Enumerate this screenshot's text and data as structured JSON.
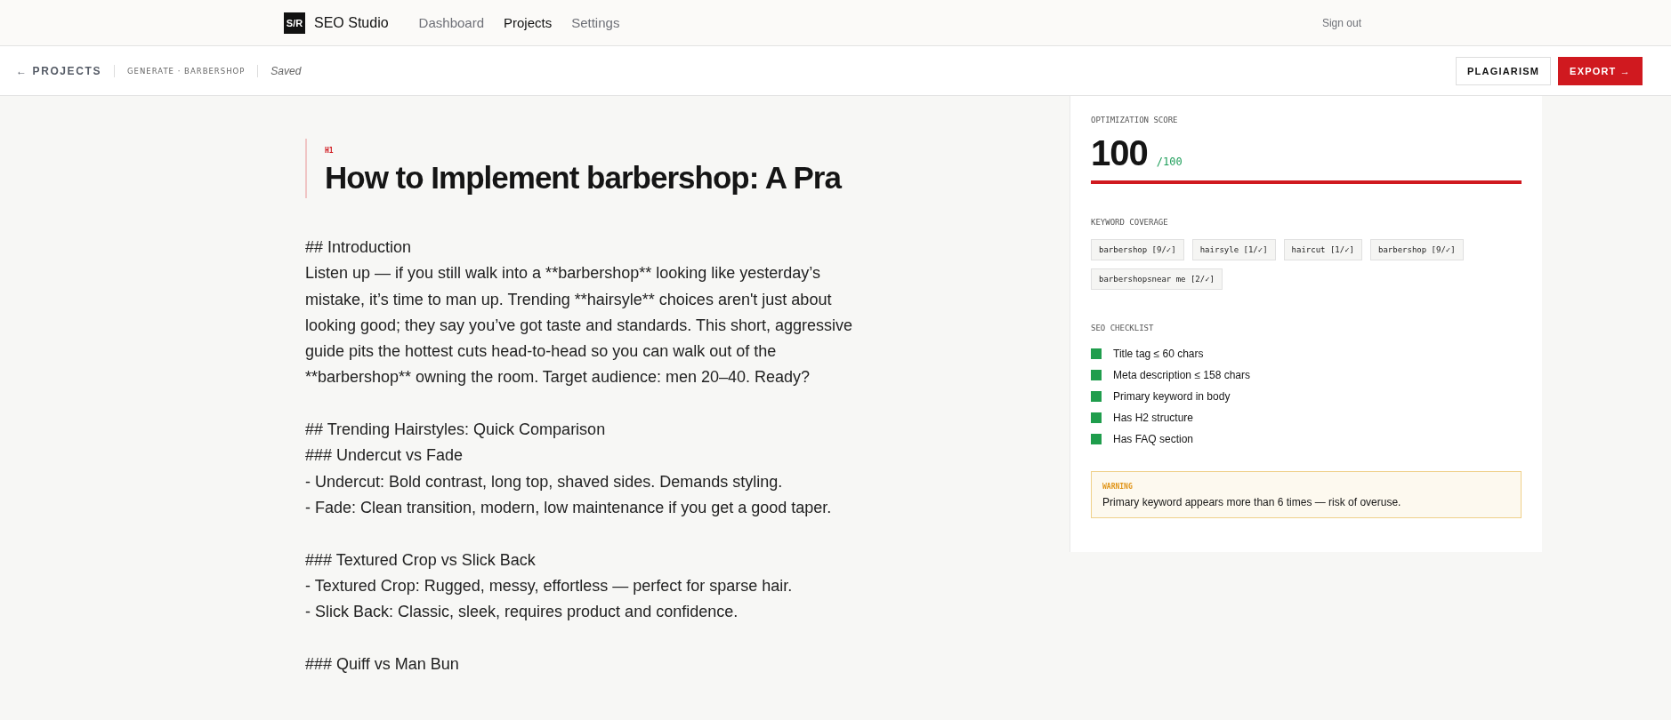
{
  "top_nav": {
    "logo": "S/R",
    "brand": "SEO Studio",
    "items": [
      {
        "label": "Dashboard",
        "selected": false
      },
      {
        "label": "Projects",
        "selected": true
      },
      {
        "label": "Settings",
        "selected": false
      }
    ],
    "sign_out": "Sign out"
  },
  "toolbar": {
    "back": "← PROJECTS",
    "breadcrumb": "GENERATE · BARBERSHOP",
    "status": "Saved",
    "buttons": [
      {
        "label": "PLAGIARISM",
        "kind": "outline"
      },
      {
        "label": "EXPORT →",
        "kind": "primary"
      }
    ]
  },
  "editor": {
    "heading_tag": "H1",
    "title": "How to Implement barbershop: A Pra",
    "body": "## Introduction\nListen up — if you still walk into a **barbershop** looking like yesterday’s mistake, it’s time to man up. Trending **hairsyle** choices aren't just about looking good; they say you’ve got taste and standards. This short, aggressive guide pits the hottest cuts head-to-head so you can walk out of the **barbershop** owning the room. Target audience: men 20–40. Ready?\n\n## Trending Hairstyles: Quick Comparison\n### Undercut vs Fade\n- Undercut: Bold contrast, long top, shaved sides. Demands styling.\n- Fade: Clean transition, modern, low maintenance if you get a good taper.\n\n### Textured Crop vs Slick Back\n- Textured Crop: Rugged, messy, effortless — perfect for sparse hair.\n- Slick Back: Classic, sleek, requires product and confidence.\n\n### Quiff vs Man Bun"
  },
  "panel": {
    "score_label": "OPTIMIZATION SCORE",
    "score": "100",
    "score_max": "/100",
    "score_bar": {
      "level": 1
    },
    "keyword_label": "KEYWORD COVERAGE",
    "keywords": [
      "barbershop [9/✓]",
      "hairsyle [1/✓]",
      "haircut [1/✓]",
      "barbershop [9/✓]",
      "barbershopsnear me [2/✓]"
    ],
    "checklist_label": "SEO CHECKLIST",
    "checklist": [
      {
        "label": "Title tag ≤ 60 chars",
        "passed": true
      },
      {
        "label": "Meta description ≤ 158 chars",
        "passed": true
      },
      {
        "label": "Primary keyword in body",
        "passed": true
      },
      {
        "label": "Has H2 structure",
        "passed": true
      },
      {
        "label": "Has FAQ section",
        "passed": true
      }
    ],
    "warning": {
      "label": "WARNING",
      "message": "Primary keyword appears more than 6 times — risk of overuse."
    }
  }
}
